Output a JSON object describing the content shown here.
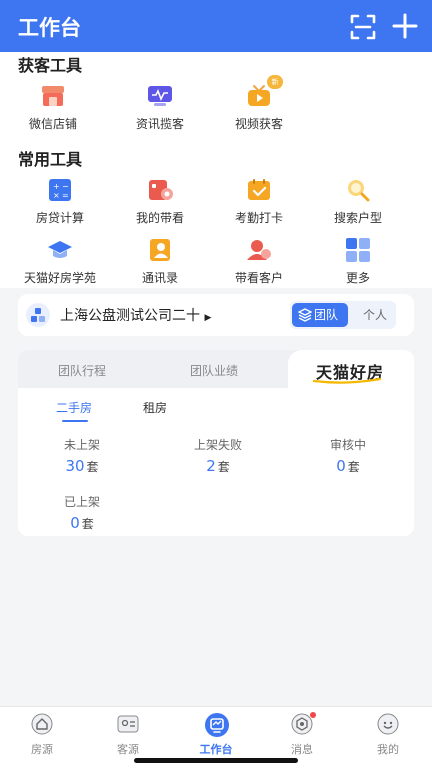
{
  "header": {
    "title": "工作台",
    "scan_icon": "scan-icon",
    "add_icon": "plus-icon",
    "bg_color": "#3d76f0"
  },
  "acquire": {
    "title": "获客工具",
    "items": [
      {
        "label": "微信店铺",
        "icon": "shop-icon"
      },
      {
        "label": "资讯揽客",
        "icon": "news-monitor-icon"
      },
      {
        "label": "视频获客",
        "icon": "video-icon",
        "badge": "新"
      }
    ]
  },
  "common": {
    "title": "常用工具",
    "items": [
      {
        "label": "房贷计算",
        "icon": "calculator-icon"
      },
      {
        "label": "我的带看",
        "icon": "showing-card-icon"
      },
      {
        "label": "考勤打卡",
        "icon": "attendance-calendar-icon"
      },
      {
        "label": "搜索户型",
        "icon": "search-magnifier-icon"
      },
      {
        "label": "天猫好房学苑",
        "icon": "graduation-cap-icon"
      },
      {
        "label": "通讯录",
        "icon": "contacts-icon"
      },
      {
        "label": "带看客户",
        "icon": "customer-icon"
      },
      {
        "label": "更多",
        "icon": "grid-more-icon"
      }
    ]
  },
  "company": {
    "name": "上海公盘测试公司二十",
    "toggle": {
      "team": "团队",
      "personal": "个人",
      "selected": "团队"
    }
  },
  "panel": {
    "tabs": [
      "团队行程",
      "团队业绩"
    ],
    "active_tab": "天猫好房",
    "subtabs": [
      "二手房",
      "租房"
    ],
    "active_subtab": "二手房",
    "stats": [
      {
        "label": "未上架",
        "value": "30",
        "unit": "套"
      },
      {
        "label": "上架失败",
        "value": "2",
        "unit": "套"
      },
      {
        "label": "审核中",
        "value": "0",
        "unit": "套"
      },
      {
        "label": "已上架",
        "value": "0",
        "unit": "套"
      }
    ]
  },
  "tabbar": {
    "items": [
      {
        "label": "房源",
        "icon": "house-icon"
      },
      {
        "label": "客源",
        "icon": "client-card-icon"
      },
      {
        "label": "工作台",
        "icon": "workbench-icon",
        "active": true
      },
      {
        "label": "消息",
        "icon": "message-icon",
        "unread_dot": true
      },
      {
        "label": "我的",
        "icon": "profile-icon"
      }
    ]
  }
}
